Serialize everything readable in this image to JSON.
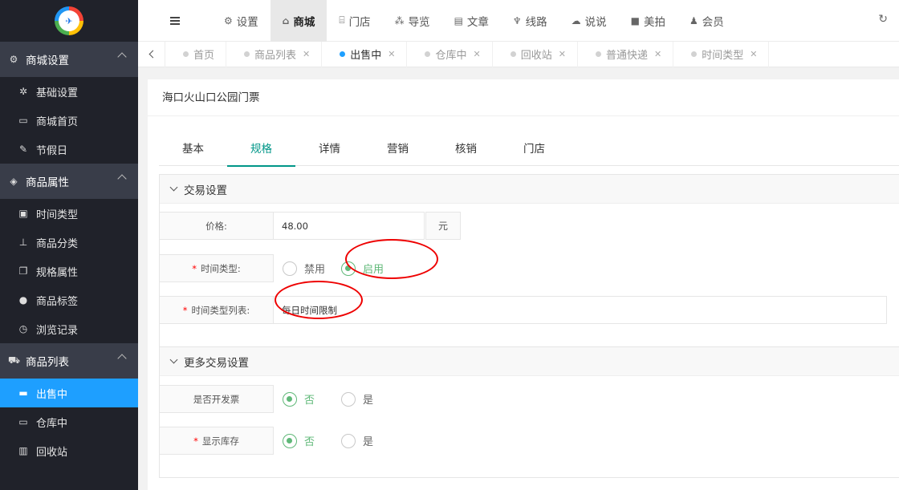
{
  "sidebar": {
    "logo_icon": "app-logo",
    "groups": [
      {
        "label": "商城设置",
        "icon": "gears-icon",
        "items": [
          {
            "label": "基础设置",
            "icon": "gear-icon"
          },
          {
            "label": "商城首页",
            "icon": "monitor-icon"
          },
          {
            "label": "节假日",
            "icon": "edit-icon"
          }
        ]
      },
      {
        "label": "商品属性",
        "icon": "cube-icon",
        "items": [
          {
            "label": "时间类型",
            "icon": "calendar-icon"
          },
          {
            "label": "商品分类",
            "icon": "sitemap-icon"
          },
          {
            "label": "规格属性",
            "icon": "clone-icon"
          },
          {
            "label": "商品标签",
            "icon": "ball-icon"
          },
          {
            "label": "浏览记录",
            "icon": "clock-icon"
          }
        ]
      },
      {
        "label": "商品列表",
        "icon": "cart-icon",
        "items": [
          {
            "label": "出售中",
            "icon": "battery-full-icon",
            "active": true
          },
          {
            "label": "仓库中",
            "icon": "battery-icon"
          },
          {
            "label": "回收站",
            "icon": "trash-icon"
          }
        ]
      }
    ]
  },
  "topnav": {
    "items": [
      {
        "label": "设置",
        "icon": "gears-icon"
      },
      {
        "label": "商城",
        "icon": "shop-icon",
        "active": true
      },
      {
        "label": "门店",
        "icon": "bank-icon"
      },
      {
        "label": "导览",
        "icon": "cubes-icon"
      },
      {
        "label": "文章",
        "icon": "newspaper-icon"
      },
      {
        "label": "线路",
        "icon": "pagelines-icon"
      },
      {
        "label": "说说",
        "icon": "wechat-icon"
      },
      {
        "label": "美拍",
        "icon": "video-icon"
      },
      {
        "label": "会员",
        "icon": "user-icon"
      }
    ]
  },
  "tabs": [
    {
      "label": "首页",
      "closable": false
    },
    {
      "label": "商品列表",
      "closable": true
    },
    {
      "label": "出售中",
      "closable": true,
      "active": true
    },
    {
      "label": "仓库中",
      "closable": true
    },
    {
      "label": "回收站",
      "closable": true
    },
    {
      "label": "普通快递",
      "closable": true
    },
    {
      "label": "时间类型",
      "closable": true
    }
  ],
  "page": {
    "title": "海口火山口公园门票",
    "form_tabs": [
      "基本",
      "规格",
      "详情",
      "营销",
      "核销",
      "门店"
    ],
    "active_form_tab": 1
  },
  "trade": {
    "section_title": "交易设置",
    "price_label": "价格:",
    "price_value": "48.00",
    "price_unit": "元",
    "time_type_label": "时间类型:",
    "time_type_options": [
      "禁用",
      "启用"
    ],
    "time_type_selected": 1,
    "time_list_label": "时间类型列表:",
    "time_list_value": "每日时间限制"
  },
  "more": {
    "section_title": "更多交易设置",
    "invoice_label": "是否开发票",
    "invoice_options": [
      "否",
      "是"
    ],
    "invoice_selected": 0,
    "stock_label": "显示库存",
    "stock_options": [
      "否",
      "是"
    ],
    "stock_selected": 0
  },
  "colors": {
    "sidebar_bg": "#20222a",
    "group_bg": "#393d49",
    "active_blue": "#1e9fff",
    "accent_green": "#009688",
    "radio_green": "#5fb878",
    "annotation_red": "#e00000"
  }
}
